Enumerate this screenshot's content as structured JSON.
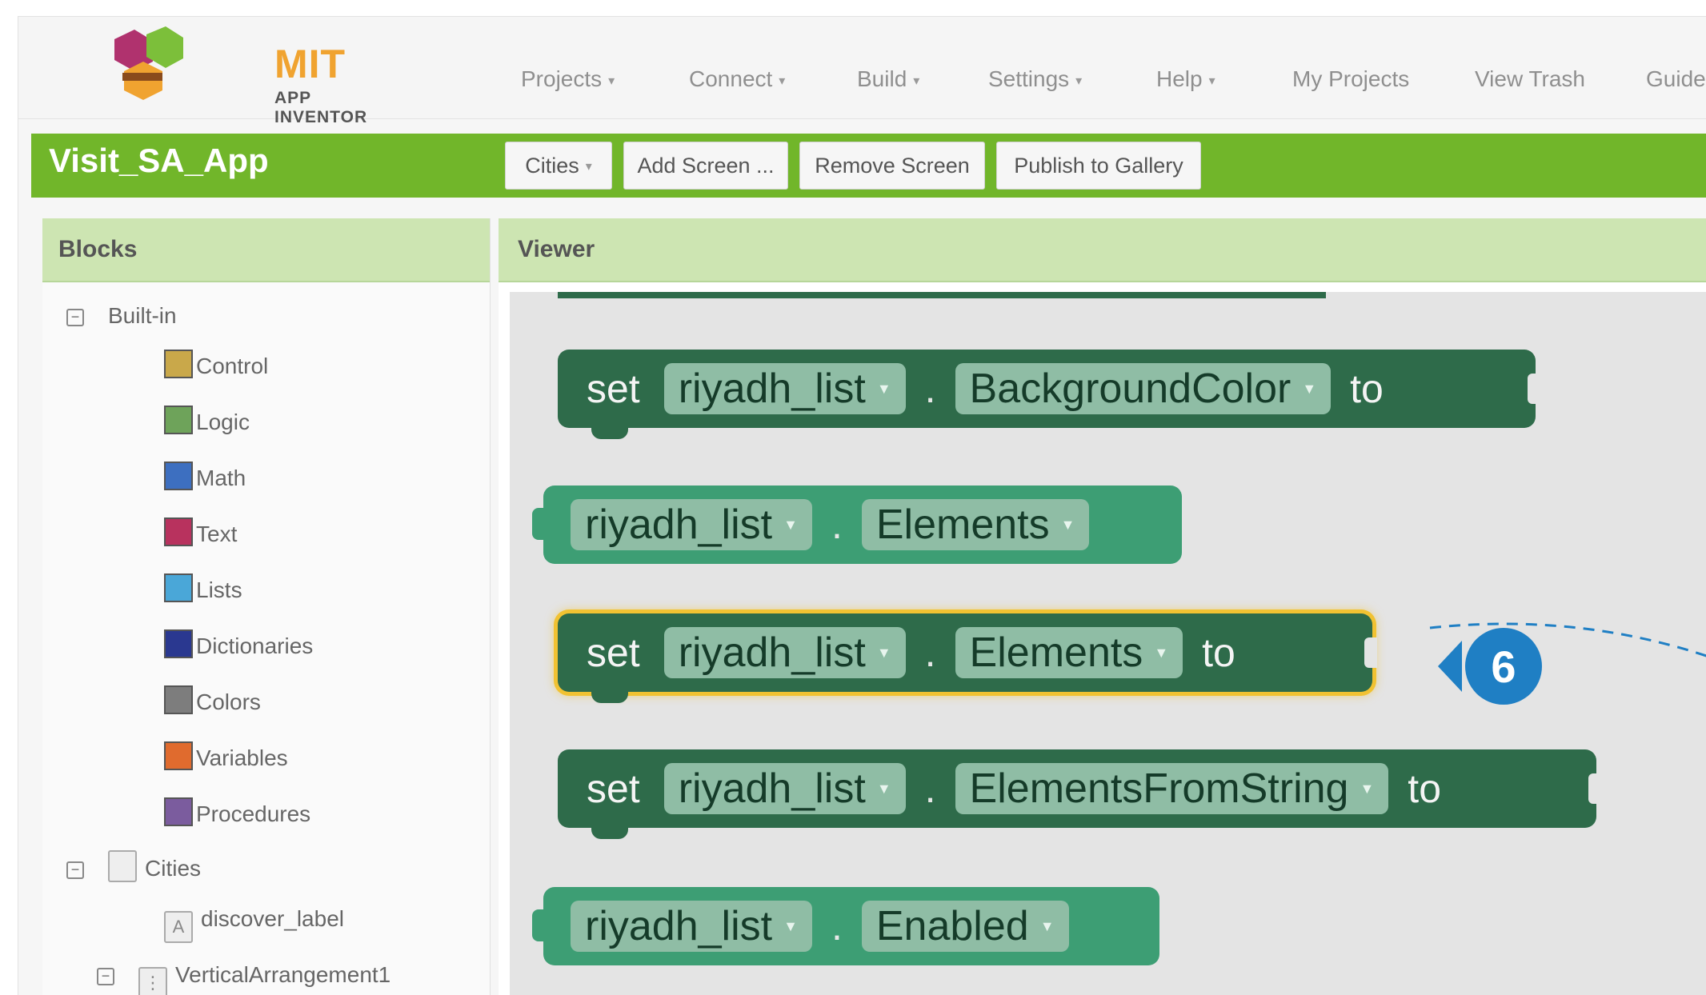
{
  "logo": {
    "title": "MIT",
    "subtitle": "APP INVENTOR"
  },
  "nav": {
    "items": [
      {
        "label": "Projects",
        "has_menu": true
      },
      {
        "label": "Connect",
        "has_menu": true
      },
      {
        "label": "Build",
        "has_menu": true
      },
      {
        "label": "Settings",
        "has_menu": true
      },
      {
        "label": "Help",
        "has_menu": true
      },
      {
        "label": "My Projects",
        "has_menu": false
      },
      {
        "label": "View Trash",
        "has_menu": false
      },
      {
        "label": "Guide",
        "has_menu": false
      }
    ]
  },
  "project": {
    "name": "Visit_SA_App",
    "screen_select": "Cities",
    "add_screen": "Add Screen ...",
    "remove_screen": "Remove Screen",
    "publish": "Publish to Gallery"
  },
  "blocks_panel": {
    "title": "Blocks",
    "builtin_label": "Built-in",
    "builtin": [
      {
        "label": "Control",
        "color": "#c9a84a"
      },
      {
        "label": "Logic",
        "color": "#6ea35a"
      },
      {
        "label": "Math",
        "color": "#3d6fc0"
      },
      {
        "label": "Text",
        "color": "#b8325e"
      },
      {
        "label": "Lists",
        "color": "#4aa7d8"
      },
      {
        "label": "Dictionaries",
        "color": "#2a3890"
      },
      {
        "label": "Colors",
        "color": "#7d7d7d"
      },
      {
        "label": "Variables",
        "color": "#e06b2e"
      },
      {
        "label": "Procedures",
        "color": "#7b5c9e"
      }
    ],
    "screen_label": "Cities",
    "components": [
      {
        "label": "discover_label",
        "icon": "A"
      },
      {
        "label": "VerticalArrangement1",
        "icon": "⋮"
      }
    ]
  },
  "viewer": {
    "title": "Viewer",
    "blocks": [
      {
        "kind": "setter",
        "component": "riyadh_list",
        "property": "BackgroundColor",
        "set": "set",
        "to": "to",
        "dot": "."
      },
      {
        "kind": "getter",
        "component": "riyadh_list",
        "property": "Elements",
        "dot": "."
      },
      {
        "kind": "setter",
        "component": "riyadh_list",
        "property": "Elements",
        "set": "set",
        "to": "to",
        "dot": ".",
        "selected": true
      },
      {
        "kind": "setter",
        "component": "riyadh_list",
        "property": "ElementsFromString",
        "set": "set",
        "to": "to",
        "dot": "."
      },
      {
        "kind": "getter",
        "component": "riyadh_list",
        "property": "Enabled",
        "dot": "."
      }
    ],
    "callout_number": "6"
  },
  "colors": {
    "brand_green": "#71b62a",
    "setter_block": "#2e6b4a",
    "getter_block": "#3d9e74",
    "selection_highlight": "#f1c232",
    "callout_blue": "#1f7fc4"
  }
}
